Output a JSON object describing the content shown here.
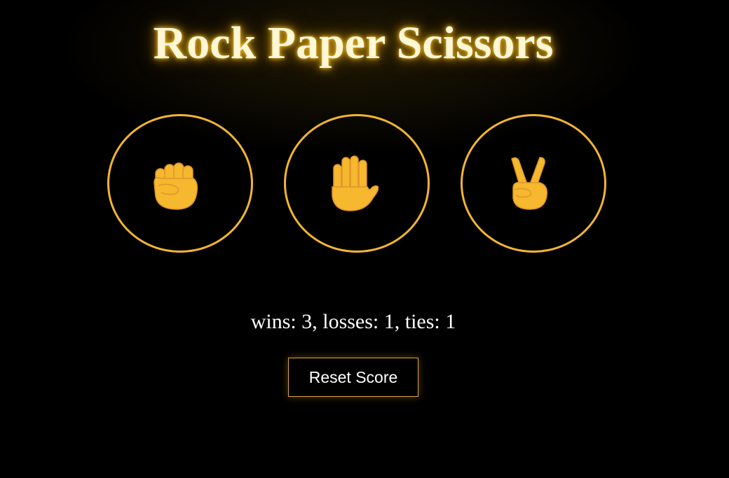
{
  "title": "Rock Paper Scissors",
  "choices": [
    {
      "id": "rock",
      "icon": "raised-fist-icon"
    },
    {
      "id": "paper",
      "icon": "raised-hand-icon"
    },
    {
      "id": "scissors",
      "icon": "victory-hand-icon"
    }
  ],
  "score": {
    "text": "wins: 3, losses: 1, ties: 1",
    "wins": 3,
    "losses": 1,
    "ties": 1
  },
  "reset_label": "Reset Score",
  "colors": {
    "background": "#000000",
    "accent": "#f2b531",
    "title_glow": "#ffc828",
    "hand": "#f5b82e"
  }
}
